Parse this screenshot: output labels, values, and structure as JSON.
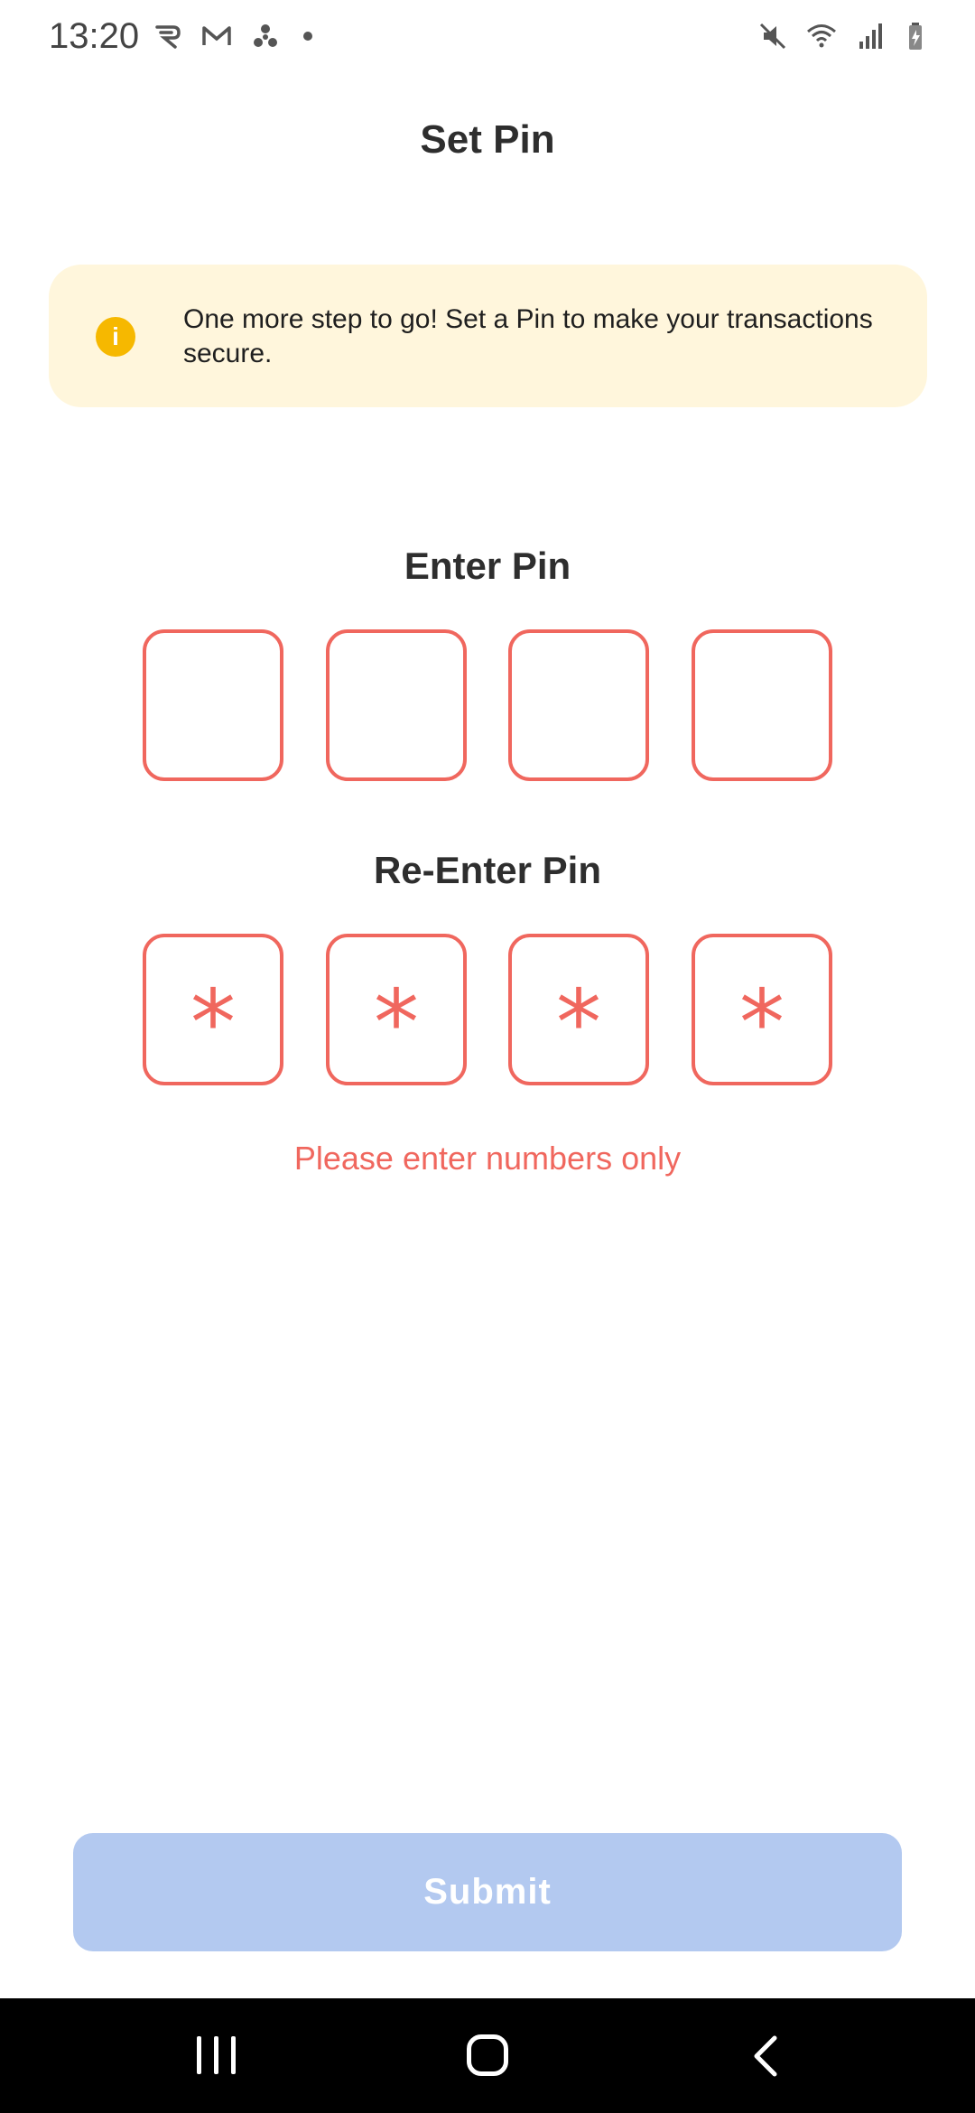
{
  "status_bar": {
    "time": "13:20",
    "left_icons": [
      "r-app-icon",
      "gmail-icon",
      "fan-icon",
      "dot-icon"
    ],
    "right_icons": [
      "mute-icon",
      "wifi-icon",
      "signal-icon",
      "battery-icon"
    ]
  },
  "header": {
    "title": "Set Pin"
  },
  "info_banner": {
    "icon": "info-icon",
    "icon_glyph": "i",
    "text": "One more step to go! Set a Pin to make your transactions secure.",
    "background": "#fff6dc",
    "icon_color": "#f6b800"
  },
  "enter_pin": {
    "label": "Enter Pin",
    "digits": [
      "",
      "",
      "",
      ""
    ]
  },
  "reenter_pin": {
    "label": "Re-Enter Pin",
    "digits": [
      "*",
      "*",
      "*",
      "*"
    ]
  },
  "error": {
    "message": "Please enter numbers only",
    "color": "#f0675e"
  },
  "submit": {
    "label": "Submit",
    "enabled": false,
    "color": "#b3c9f0"
  },
  "nav_bar": {
    "icons": [
      "recent-apps-icon",
      "home-icon",
      "back-icon"
    ]
  }
}
